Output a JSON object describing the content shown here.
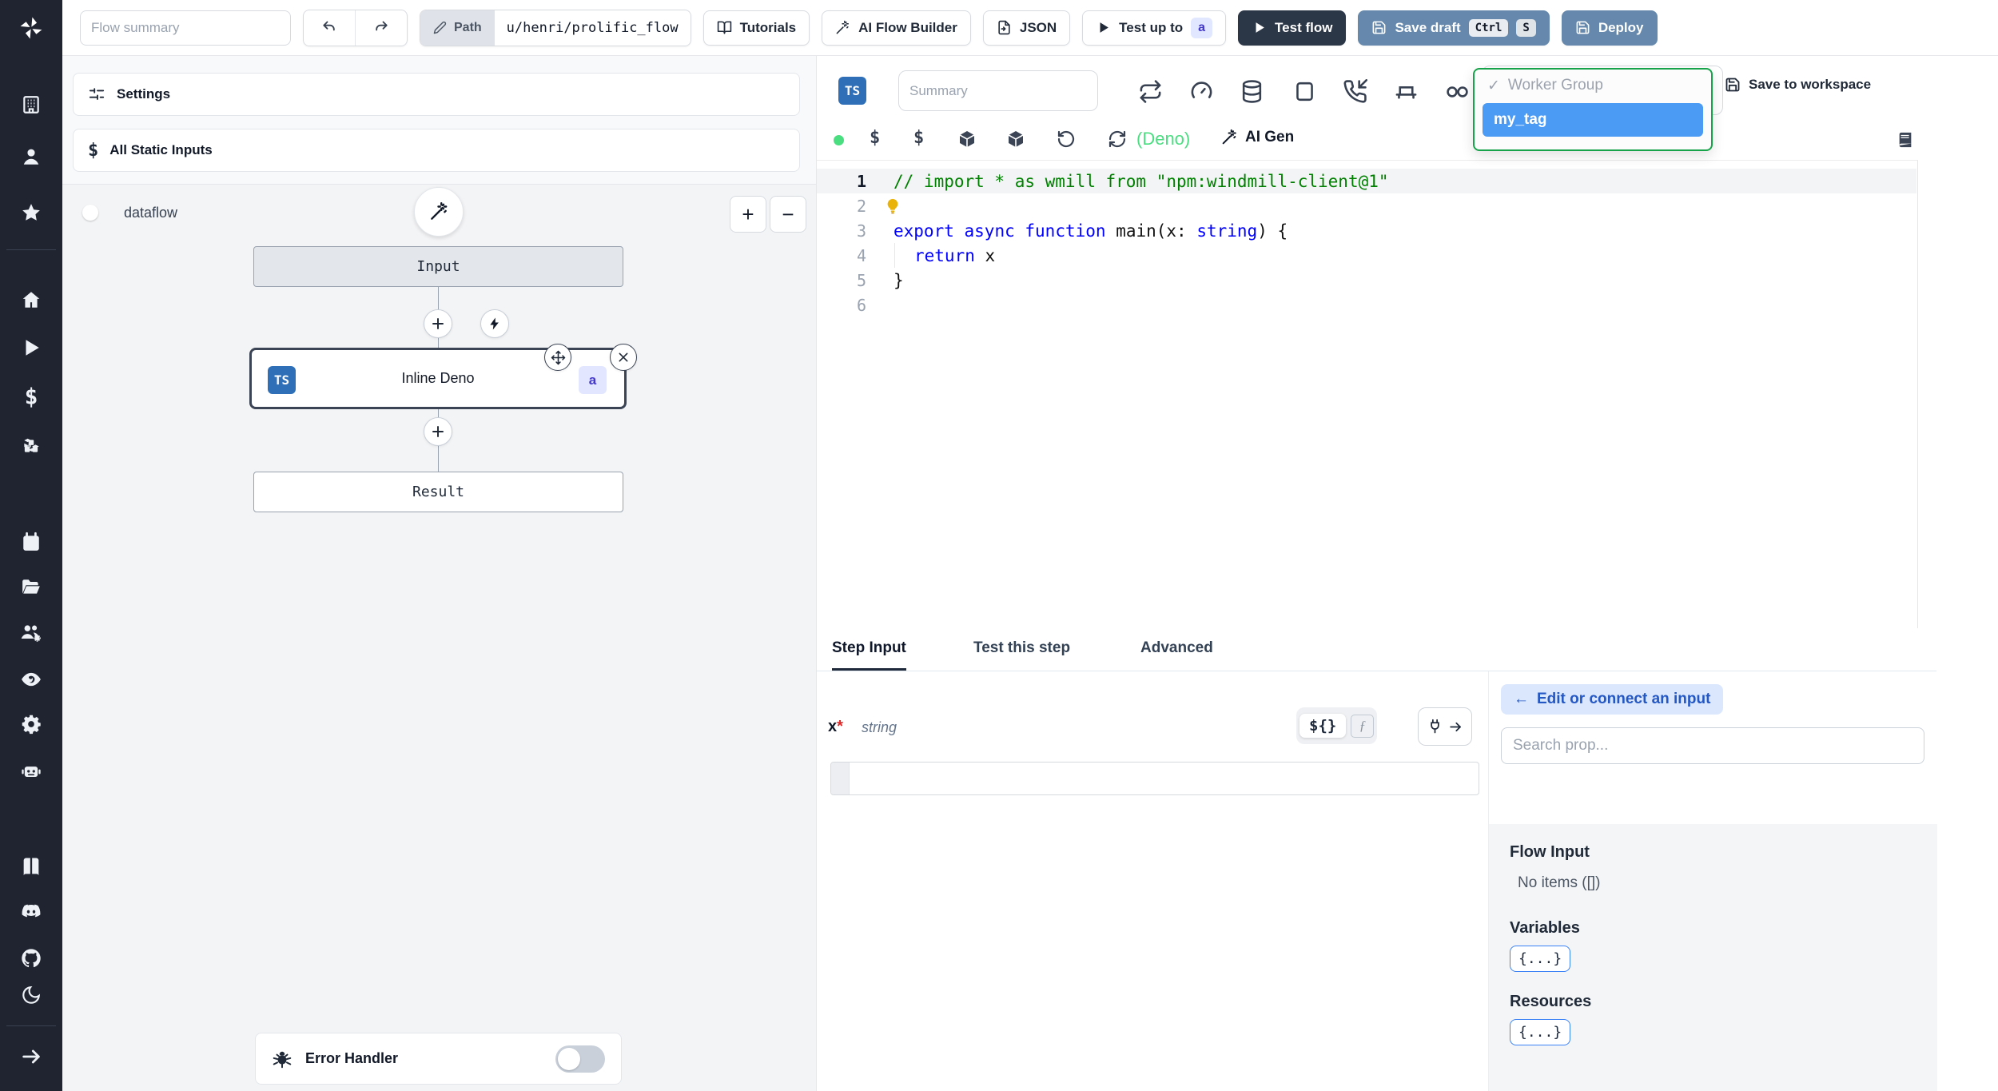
{
  "topbar": {
    "flow_summary_placeholder": "Flow summary",
    "path_label": "Path",
    "path_value": "u/henri/prolific_flow",
    "tutorials": "Tutorials",
    "ai_flow_builder": "AI Flow Builder",
    "json": "JSON",
    "test_up_to": "Test up to",
    "test_up_to_badge": "a",
    "test_flow": "Test flow",
    "save_draft": "Save draft",
    "kbd_ctrl": "Ctrl",
    "kbd_s": "S",
    "deploy": "Deploy"
  },
  "sidebar": {
    "icons": [
      "windmill-logo",
      "building",
      "user",
      "star",
      "home",
      "play",
      "dollar",
      "cubes",
      "calendar",
      "folder",
      "user-group",
      "eye",
      "gear",
      "robot",
      "book",
      "discord",
      "github",
      "moon",
      "arrow-right"
    ]
  },
  "flow_panel": {
    "settings": "Settings",
    "all_static_inputs": "All Static Inputs",
    "dataflow": "dataflow",
    "zoom_in": "+",
    "zoom_out": "−",
    "nodes": {
      "input": "Input",
      "step_lang": "TS",
      "step": "Inline Deno",
      "step_badge": "a",
      "result": "Result"
    },
    "error_handler": "Error Handler"
  },
  "editor": {
    "lang_badge": "TS",
    "summary_placeholder": "Summary",
    "trigger_icons": [
      "repeat",
      "gauge",
      "database",
      "tablet",
      "phone-incoming",
      "bench",
      "double-o"
    ],
    "deno_label": "(Deno)",
    "ai_gen": "AI Gen",
    "dropdown": {
      "check": "✓",
      "group": "Worker Group",
      "selected": "my_tag"
    },
    "save_to_workspace": "Save to workspace",
    "gutter": [
      "1",
      "2",
      "3",
      "4",
      "5",
      "6"
    ],
    "code": {
      "line1": "// import * as wmill from \"npm:windmill-client@1\"",
      "line3_export": "export",
      "line3_sp1": " ",
      "line3_async": "async",
      "line3_sp2": " ",
      "line3_function": "function",
      "line3_main": " main(x: ",
      "line3_string": "string",
      "line3_end": ") {",
      "line4_return": "return",
      "line4_rest": " x",
      "line5": "}"
    }
  },
  "bottom": {
    "tabs": [
      "Step Input",
      "Test this step",
      "Advanced"
    ],
    "arg_name": "x",
    "required_mark": "*",
    "arg_type": "string",
    "interp_toggle": "${}",
    "fn_toggle": "ƒ",
    "edit_connect_arrow": "←",
    "edit_connect": "Edit or connect an input",
    "search_placeholder": "Search prop...",
    "flow_input": "Flow Input",
    "no_items": "No items ([])",
    "variables": "Variables",
    "variables_chip": "{...}",
    "resources": "Resources",
    "resources_chip": "{...}"
  },
  "colors": {
    "sidebar_bg": "#1f2430",
    "dark_button": "#2b3647",
    "slate_button": "#6588ac",
    "dropdown_border": "#16a34a",
    "selected_tag_bg": "#4b9bf5",
    "badge_bg": "#e0e7ff",
    "badge_text": "#4338ca",
    "ts_badge_bg": "#2e6fb8",
    "status_dot": "#4ade80",
    "code_comment": "#008000",
    "code_keyword": "#0000ff",
    "edit_connect_bg": "#dbe7fd",
    "edit_connect_text": "#2357c4"
  }
}
